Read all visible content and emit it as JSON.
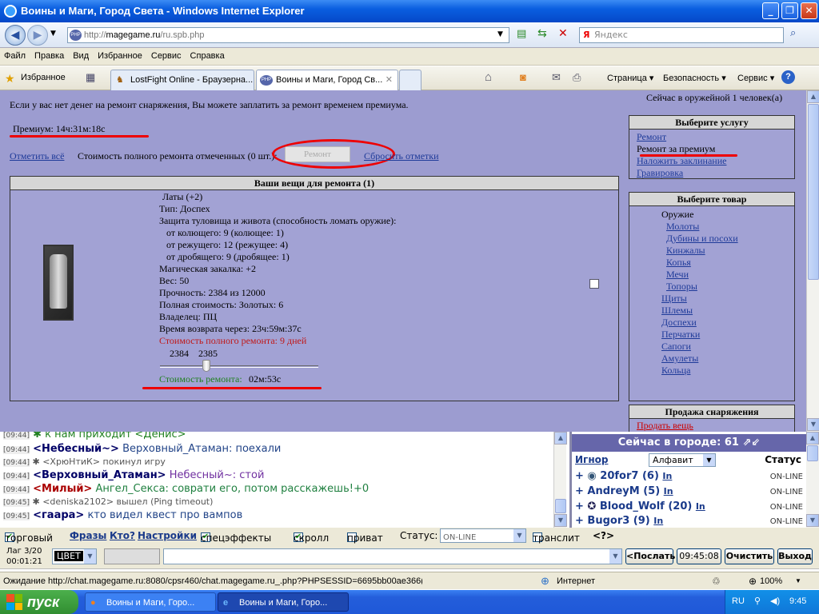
{
  "window": {
    "title": "Воины и Маги, Город Света - Windows Internet Explorer",
    "min": "_",
    "max": "❐",
    "close": "✕"
  },
  "address": {
    "prefix": "http://",
    "host": "magegame.ru",
    "path": "/ru.spb.php",
    "search_placeholder": "Яндекс",
    "yandex": "Я"
  },
  "menu": [
    "Файл",
    "Правка",
    "Вид",
    "Избранное",
    "Сервис",
    "Справка"
  ],
  "favbar": {
    "favorites": "Избранное",
    "tabs": [
      "LostFight Online - Браузерна...",
      "Воины и Маги, Город Св..."
    ],
    "tools": [
      "Страница ▾",
      "Безопасность ▾",
      "Сервис ▾"
    ]
  },
  "page": {
    "notice": "Если у вас нет денег на ремонт снаряжения, Вы можете заплатить за ремонт временем  премиума.",
    "people_in_shop": "Сейчас в оружейной 1 человек(а)",
    "premium": "Премиум: 14ч:31м:18с",
    "mark_all": "Отметить всё",
    "full_cost": "Стоимость полного ремонта отмеченных (0 шт.):",
    "repair_btn": "Ремонт",
    "reset_marks": "Сбросить отметки",
    "items_header": "Ваши вещи для ремонта (1)",
    "item": {
      "name": "Латы (+2)",
      "type": "Тип: Доспех",
      "protection": "Защита туловища и живота (способность ломать оружие):",
      "pierce": "от колющего: 9 (колющее: 1)",
      "cut": "от режущего: 12 (режущее: 4)",
      "crush": "от дробящего: 9 (дробящее: 1)",
      "magic": "Магическая закалка: +2",
      "weight": "Вес: 50",
      "durability": "Прочность: 2384 из 12000",
      "full_price": "Полная стоимость: Золотых: 6",
      "owner": "Владелец: ПЦ",
      "return_time": "Время возврата через: 23ч:59м:37с",
      "full_repair": "Стоимость полного ремонта: 9 дней",
      "slider_min": "2384",
      "slider_max": "2385",
      "slider_level": 0.28,
      "repair_cost_label": "Стоимость ремонта:",
      "repair_cost_value": " 02м:53с"
    },
    "service": {
      "header": "Выберите услугу",
      "items": [
        "Ремонт",
        "Ремонт за премиум",
        "Наложить заклинание",
        "Гравировка"
      ]
    },
    "goods": {
      "header": "Выберите товар",
      "weapons": "Оружие",
      "sub": [
        "Молоты",
        "Дубины и посохи",
        "Кинжалы",
        "Копья",
        "Мечи",
        "Топоры"
      ],
      "items": [
        "Щиты",
        "Шлемы",
        "Доспехи",
        "Перчатки",
        "Сапоги",
        "Амулеты",
        "Кольца"
      ]
    },
    "sell": {
      "header": "Продажа снаряжения",
      "link": "Продать вещь"
    }
  },
  "chat": [
    {
      "time": "[09:44]",
      "pre": "✱ ",
      "nick": "",
      "text": "к нам приходит <Денис>"
    },
    {
      "time": "[09:44]",
      "pre": "",
      "nick": "<Небесный~>",
      "text": " Верховный_Атаман: поехали"
    },
    {
      "time": "[09:44]",
      "pre": "✱ ",
      "nick": "",
      "text": "<ХрюНтиК> покинул игру"
    },
    {
      "time": "[09:44]",
      "pre": "",
      "nick": "<Верховный_Атаман>",
      "text": " Небесный~: стой"
    },
    {
      "time": "[09:44]",
      "pre": "",
      "nick": "<Милый>",
      "text": " Ангел_Секса: соврати его, потом расскажешь!+0"
    },
    {
      "time": "[09:45]",
      "pre": "✱ ",
      "nick": "",
      "text": "<deniska2102> вышел (Ping timeout)"
    },
    {
      "time": "[09:45]",
      "pre": "",
      "nick": "<гаара>",
      "text": " кто видел квест про вампов"
    }
  ],
  "city": {
    "header": "Сейчас в городе: 61",
    "ignore": "Игнор",
    "sort": "Алфавит",
    "status": "Статус",
    "users": [
      {
        "name": "20for7 (6)",
        "info": "In",
        "status": "ON-LINE"
      },
      {
        "name": "AndreyM (5)",
        "info": "In",
        "status": "ON-LINE"
      },
      {
        "name": "Blood_Wolf (20)",
        "info": "In",
        "status": "ON-LINE"
      },
      {
        "name": "Bugor3 (9)",
        "info": "In",
        "status": "ON-LINE"
      }
    ]
  },
  "options": {
    "trade": "торговый",
    "phrases": "Фразы",
    "who": "Кто?",
    "settings": "Настройки",
    "effects": "спецэффекты",
    "scroll": "скролл",
    "private": "приват",
    "status_label": "Статус:",
    "status_value": "ON-LINE",
    "translit": "транслит",
    "help": "<?>"
  },
  "inputbar": {
    "lag": "Лаг 3/20",
    "timer": "00:01:21",
    "color": "ЦВЕТ",
    "send": "<Послать",
    "time": "09:45:08",
    "clear": "Очистить",
    "exit": "Выход"
  },
  "status": {
    "text": "Ожидание http://chat.magegame.ru:8080/cpsr460/chat.magegame.ru_.php?PHPSESSID=6695bb00ae366(",
    "zone": "Интернет",
    "zoom": "100%"
  },
  "taskbar": {
    "start": "пуск",
    "tasks": [
      "Воины и Маги, Горо...",
      "Воины и Маги, Горо..."
    ],
    "lang": "RU",
    "clock": "9:45"
  }
}
